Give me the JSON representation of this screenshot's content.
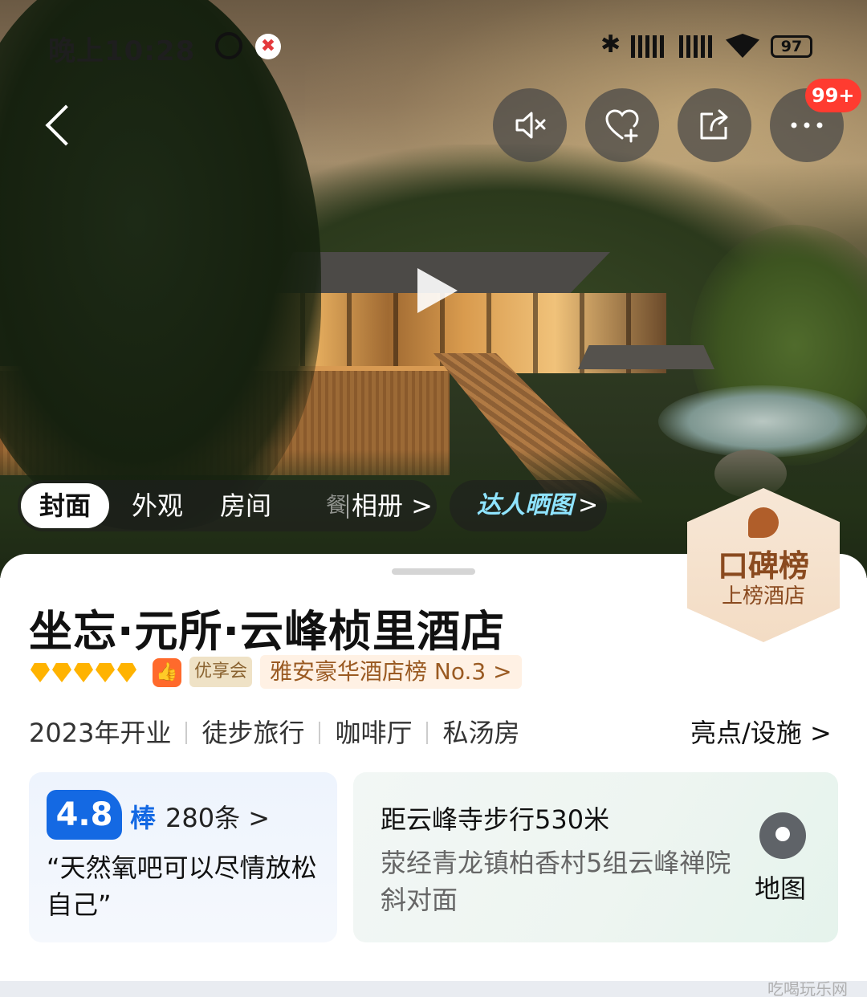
{
  "status_bar": {
    "time": "晚上10:28",
    "battery": "97"
  },
  "top_nav": {
    "notification_badge": "99+"
  },
  "gallery_tabs": [
    "封面",
    "外观",
    "房间"
  ],
  "gallery_album": "相册 >",
  "daren_photos": "达人晒图",
  "daren_arrow": ">",
  "koubei": {
    "title": "口碑榜",
    "subtitle": "上榜酒店"
  },
  "hotel": {
    "name": "坐忘·元所·云峰桢里酒店",
    "diamonds": 5,
    "member_tag": "优享会",
    "ranking": "雅安豪华酒店榜 No.3 >"
  },
  "features": [
    "2023年开业",
    "徒步旅行",
    "咖啡厅",
    "私汤房"
  ],
  "highlights_link": "亮点/设施 >",
  "review": {
    "score": "4.8",
    "word": "棒",
    "count": "280条 >",
    "quote": "“天然氧吧可以尽情放松自己”"
  },
  "location": {
    "distance": "距云峰寺步行530米",
    "address": "荥经青龙镇柏香村5组云峰禅院斜对面",
    "map_label": "地图"
  },
  "watermark": "吃喝玩乐网",
  "colors": {
    "accent_blue": "#1469e3",
    "badge_red": "#ff3b30",
    "diamond_gold": "#ffb300"
  }
}
